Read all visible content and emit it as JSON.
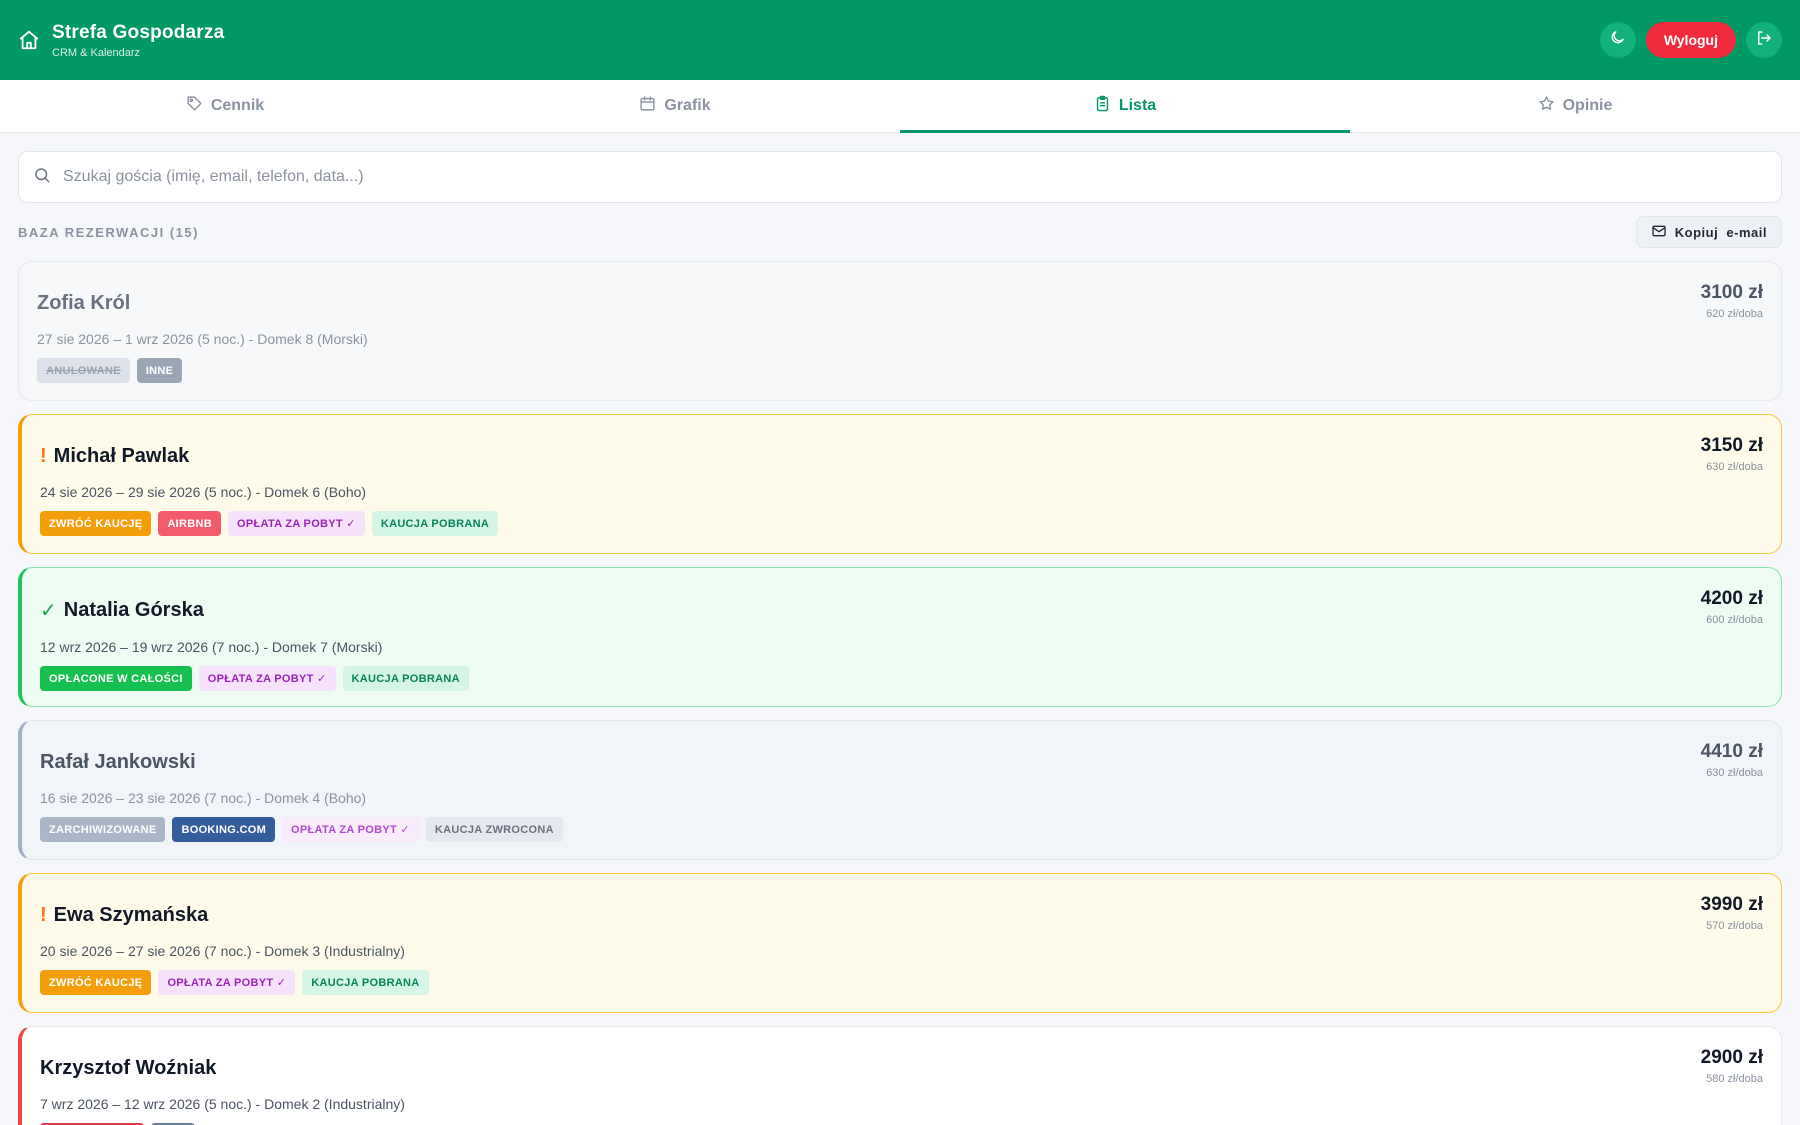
{
  "header": {
    "title": "Strefa Gospodarza",
    "subtitle": "CRM & Kalendarz",
    "logout_label": "Wyloguj"
  },
  "tabs": [
    {
      "label": "Cennik",
      "icon": "tag-icon"
    },
    {
      "label": "Grafik",
      "icon": "calendar-icon"
    },
    {
      "label": "Lista",
      "icon": "clipboard-icon",
      "active": true
    },
    {
      "label": "Opinie",
      "icon": "star-icon"
    }
  ],
  "search": {
    "placeholder": "Szukaj gościa (imię, email, telefon, data...)"
  },
  "list": {
    "title": "BAZA REZERWACJI (15)",
    "copy_label": "Kopiuj  e-mail"
  },
  "reservations": [
    {
      "name": "Zofia Król",
      "mark": "",
      "details": "27 sie 2026 – 1 wrz 2026 (5 noc.) - Domek 8 (Morski)",
      "price": "3100 zł",
      "per_night": "620 zł/doba",
      "badges": [
        "ANULOWANE",
        "INNE"
      ]
    },
    {
      "name": "Michał Pawlak",
      "mark": "!",
      "details": "24 sie 2026 – 29 sie 2026 (5 noc.) - Domek 6 (Boho)",
      "price": "3150 zł",
      "per_night": "630 zł/doba",
      "badges": [
        "ZWRÓĆ KAUCJĘ",
        "AIRBNB",
        "OPŁATA ZA POBYT ✓",
        "KAUCJA POBRANA"
      ]
    },
    {
      "name": "Natalia Górska",
      "mark": "✓",
      "details": "12 wrz 2026 – 19 wrz 2026 (7 noc.) - Domek 7 (Morski)",
      "price": "4200 zł",
      "per_night": "600 zł/doba",
      "badges": [
        "OPŁACONE W CAŁOŚCI",
        "OPŁATA ZA POBYT ✓",
        "KAUCJA POBRANA"
      ]
    },
    {
      "name": "Rafał Jankowski",
      "mark": "",
      "details": "16 sie 2026 – 23 sie 2026 (7 noc.) - Domek 4 (Boho)",
      "price": "4410 zł",
      "per_night": "630 zł/doba",
      "badges": [
        "ZARCHIWIZOWANE",
        "BOOKING.COM",
        "OPŁATA ZA POBYT ✓",
        "KAUCJA ZWROCONA"
      ]
    },
    {
      "name": "Ewa Szymańska",
      "mark": "!",
      "details": "20 sie 2026 – 27 sie 2026 (7 noc.) - Domek 3 (Industrialny)",
      "price": "3990 zł",
      "per_night": "570 zł/doba",
      "badges": [
        "ZWRÓĆ KAUCJĘ",
        "OPŁATA ZA POBYT ✓",
        "KAUCJA POBRANA"
      ]
    },
    {
      "name": "Krzysztof Woźniak",
      "mark": "",
      "details": "7 wrz 2026 – 12 wrz 2026 (5 noc.) - Domek 2 (Industrialny)",
      "price": "2900 zł",
      "per_night": "580 zł/doba",
      "badges": [
        "",
        ""
      ]
    }
  ],
  "colors": {
    "brand": "#009966",
    "logout": "#ef2b3d",
    "active_tab": "#059669"
  }
}
